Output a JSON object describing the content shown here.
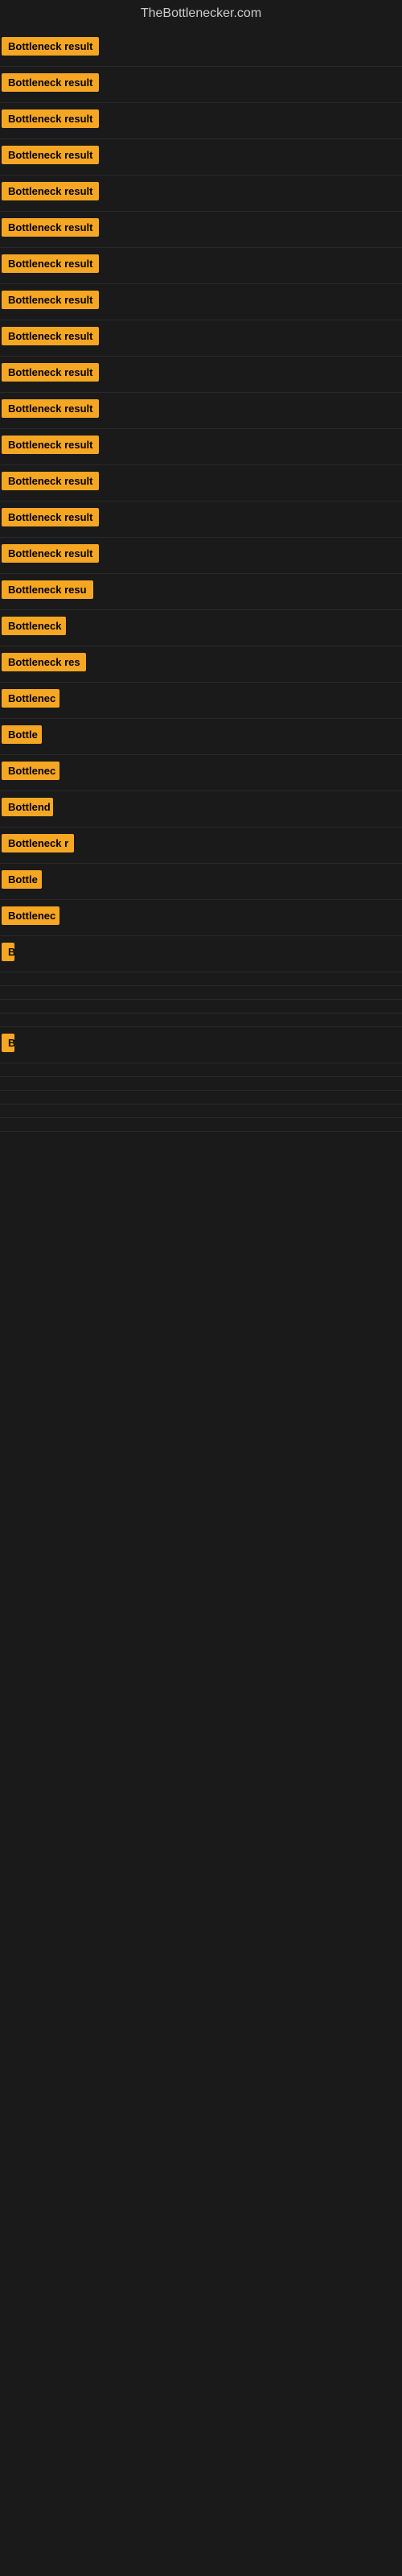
{
  "site": {
    "title": "TheBottlenecker.com"
  },
  "results": [
    {
      "id": 1,
      "label": "Bottleneck result",
      "width": 130
    },
    {
      "id": 2,
      "label": "Bottleneck result",
      "width": 130
    },
    {
      "id": 3,
      "label": "Bottleneck result",
      "width": 130
    },
    {
      "id": 4,
      "label": "Bottleneck result",
      "width": 130
    },
    {
      "id": 5,
      "label": "Bottleneck result",
      "width": 130
    },
    {
      "id": 6,
      "label": "Bottleneck result",
      "width": 130
    },
    {
      "id": 7,
      "label": "Bottleneck result",
      "width": 130
    },
    {
      "id": 8,
      "label": "Bottleneck result",
      "width": 130
    },
    {
      "id": 9,
      "label": "Bottleneck result",
      "width": 130
    },
    {
      "id": 10,
      "label": "Bottleneck result",
      "width": 130
    },
    {
      "id": 11,
      "label": "Bottleneck result",
      "width": 130
    },
    {
      "id": 12,
      "label": "Bottleneck result",
      "width": 130
    },
    {
      "id": 13,
      "label": "Bottleneck result",
      "width": 130
    },
    {
      "id": 14,
      "label": "Bottleneck result",
      "width": 130
    },
    {
      "id": 15,
      "label": "Bottleneck result",
      "width": 130
    },
    {
      "id": 16,
      "label": "Bottleneck resu",
      "width": 115
    },
    {
      "id": 17,
      "label": "Bottleneck",
      "width": 80
    },
    {
      "id": 18,
      "label": "Bottleneck res",
      "width": 105
    },
    {
      "id": 19,
      "label": "Bottlenec",
      "width": 72
    },
    {
      "id": 20,
      "label": "Bottle",
      "width": 50
    },
    {
      "id": 21,
      "label": "Bottlenec",
      "width": 72
    },
    {
      "id": 22,
      "label": "Bottlend",
      "width": 64
    },
    {
      "id": 23,
      "label": "Bottleneck r",
      "width": 90
    },
    {
      "id": 24,
      "label": "Bottle",
      "width": 50
    },
    {
      "id": 25,
      "label": "Bottlenec",
      "width": 72
    },
    {
      "id": 26,
      "label": "B",
      "width": 14
    },
    {
      "id": 27,
      "label": "",
      "width": 0
    },
    {
      "id": 28,
      "label": "",
      "width": 0
    },
    {
      "id": 29,
      "label": "",
      "width": 0
    },
    {
      "id": 30,
      "label": "",
      "width": 0
    },
    {
      "id": 31,
      "label": "B",
      "width": 14
    },
    {
      "id": 32,
      "label": "",
      "width": 0
    },
    {
      "id": 33,
      "label": "",
      "width": 0
    },
    {
      "id": 34,
      "label": "",
      "width": 0
    },
    {
      "id": 35,
      "label": "",
      "width": 0
    },
    {
      "id": 36,
      "label": "",
      "width": 0
    }
  ]
}
